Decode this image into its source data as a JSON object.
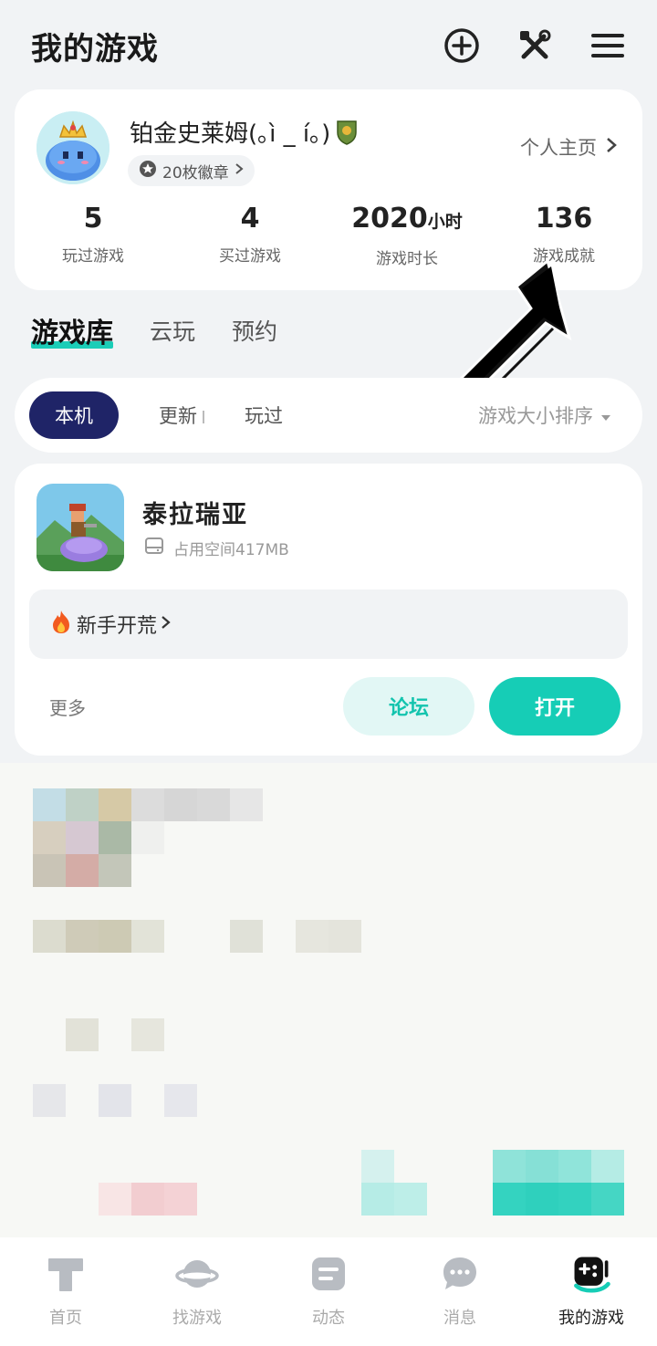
{
  "header": {
    "title": "我的游戏"
  },
  "profile": {
    "username": "铂金史莱姆(｡ì _ í｡)",
    "badges": "20枚徽章",
    "homepage_link": "个人主页",
    "stats": [
      {
        "value": "5",
        "unit": "",
        "label": "玩过游戏"
      },
      {
        "value": "4",
        "unit": "",
        "label": "买过游戏"
      },
      {
        "value": "2020",
        "unit": "小时",
        "label": "游戏时长"
      },
      {
        "value": "136",
        "unit": "",
        "label": "游戏成就"
      }
    ]
  },
  "library_tabs": [
    {
      "label": "游戏库"
    },
    {
      "label": "云玩"
    },
    {
      "label": "预约"
    }
  ],
  "filters": {
    "chips": [
      {
        "label": "本机"
      },
      {
        "label": "更新"
      },
      {
        "label": "玩过"
      }
    ],
    "sort_label": "游戏大小排序"
  },
  "game": {
    "name": "泰拉瑞亚",
    "size": "占用空间417MB",
    "starter_link": "新手开荒",
    "more_label": "更多",
    "forum_button": "论坛",
    "open_button": "打开"
  },
  "bottom_nav": [
    {
      "label": "首页",
      "icon": "home-t-icon"
    },
    {
      "label": "找游戏",
      "icon": "planet-icon"
    },
    {
      "label": "动态",
      "icon": "feed-icon"
    },
    {
      "label": "消息",
      "icon": "chat-icon"
    },
    {
      "label": "我的游戏",
      "icon": "gamepad-icon"
    }
  ],
  "colors": {
    "accent": "#16cdb6",
    "chip_active": "#1f2467",
    "background": "#f1f3f5"
  }
}
